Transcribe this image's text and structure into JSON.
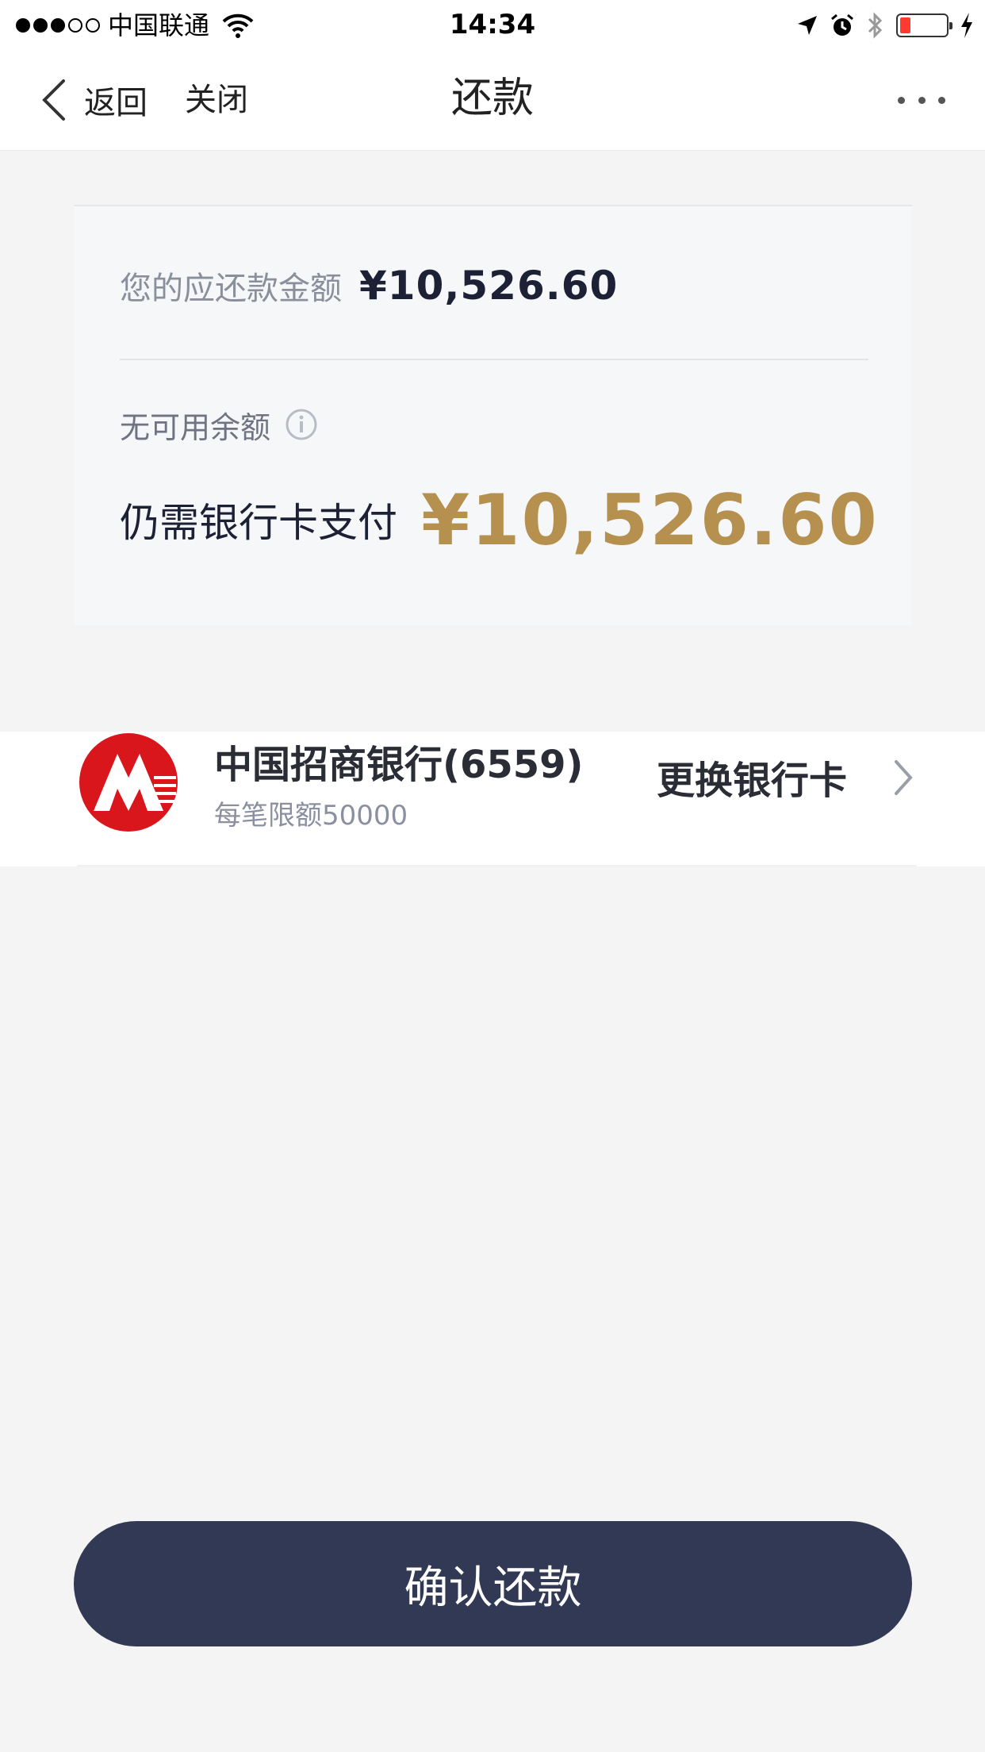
{
  "status_bar": {
    "carrier": "中国联通",
    "time": "14:34",
    "signal_full_dots": 3,
    "signal_total_dots": 5,
    "battery_level": 0.15
  },
  "nav": {
    "back_label": "返回",
    "close_label": "关闭",
    "title": "还款",
    "more_icon": "more-dots-icon"
  },
  "summary": {
    "due_label": "您的应还款金额",
    "due_amount": "¥10,526.60",
    "balance_label": "无可用余额",
    "need_label": "仍需银行卡支付",
    "need_amount": "¥10,526.60"
  },
  "bank_card": {
    "name": "中国招商银行(6559)",
    "limit": "每笔限额50000",
    "change_label": "更换银行卡",
    "logo_icon": "cmb-logo-icon"
  },
  "confirm_button": {
    "label": "确认还款"
  },
  "colors": {
    "accent_gold": "#b5904f",
    "button_navy": "#323954",
    "bank_red": "#d9161c"
  }
}
